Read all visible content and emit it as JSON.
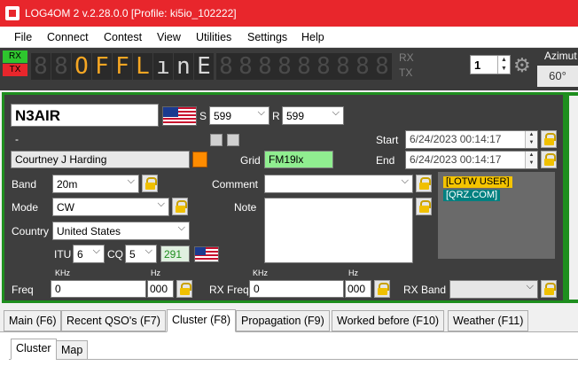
{
  "title_bar": {
    "title": "LOG4OM 2 v.2.28.0.0 [Profile: ki5io_102222]"
  },
  "menu": [
    "File",
    "Connect",
    "Contest",
    "View",
    "Utilities",
    "Settings",
    "Help"
  ],
  "toolbar": {
    "rx_label": "RX",
    "tx_label": "TX",
    "display_chars": [
      "8",
      "8",
      "O",
      "F",
      "F",
      "L",
      "ı",
      "n",
      "E",
      "8",
      "8",
      "8",
      "8",
      "8",
      "8",
      "8",
      "8",
      "8"
    ],
    "rx_right_label": "RX",
    "tx_right_label": "TX",
    "spinner_value": "1",
    "azimuth_label": "Azimut",
    "azimuth_value": "60°"
  },
  "qso": {
    "callsign": "N3AIR",
    "rst_s_label": "S",
    "rst_sent": "599",
    "rst_r_label": "R",
    "rst_rcvd": "599",
    "dash": "-",
    "name": "Courtney J Harding",
    "grid_label": "Grid",
    "grid": "FM19lx",
    "start_label": "Start",
    "start": "6/24/2023 00:14:17",
    "end_label": "End",
    "end": "6/24/2023 00:14:17",
    "band_label": "Band",
    "band": "20m",
    "comment_label": "Comment",
    "comment": "",
    "mode_label": "Mode",
    "mode": "CW",
    "note_label": "Note",
    "country_label": "Country",
    "country": "United States",
    "itu_label": "ITU",
    "itu": "6",
    "cq_label": "CQ",
    "cq": "5",
    "dxcc": "291",
    "tags": [
      "[LOTW USER]",
      "[QRZ.COM]"
    ],
    "khz_label": "KHz",
    "hz_label": "Hz",
    "freq_label": "Freq",
    "freq_khz": "0",
    "freq_hz": "000",
    "rx_freq_label": "RX Freq",
    "rx_freq_khz": "0",
    "rx_freq_hz": "000",
    "rx_band_label": "RX Band",
    "rx_band": ""
  },
  "tabs": [
    "Main (F6)",
    "Recent QSO's (F7)",
    "Cluster (F8)",
    "Propagation (F9)",
    "Worked before (F10)",
    "Weather (F11)"
  ],
  "subtabs": [
    "Cluster",
    "Map"
  ],
  "colors": {
    "title_bar": "#e8262c",
    "panel_border": "#1e8e1e",
    "grid_bg": "#90ee90",
    "tag_lotw": "#f5c400",
    "tag_qrz": "#008080",
    "display_on": "#f5a623"
  }
}
